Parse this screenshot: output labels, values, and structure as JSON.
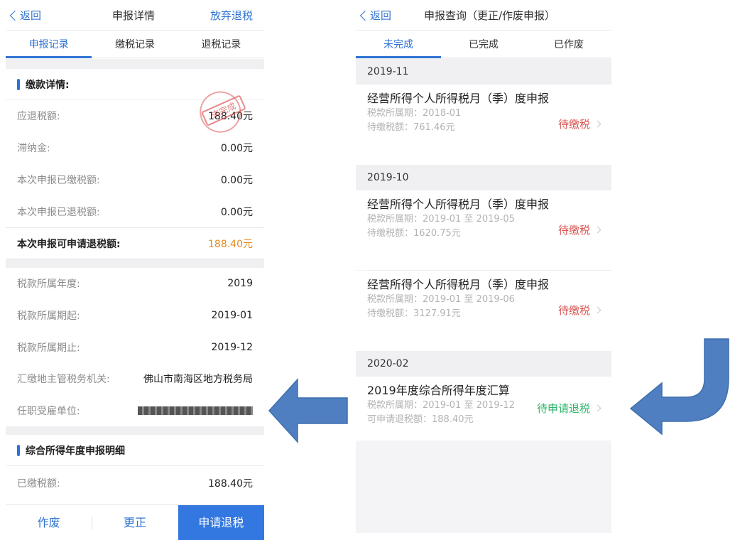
{
  "left": {
    "header": {
      "back_label": "返回",
      "title": "申报详情",
      "action_label": "放弃退税"
    },
    "tabs": [
      "申报记录",
      "缴税记录",
      "退税记录"
    ],
    "payment_section_title": "缴款详情:",
    "stamp_text": "未完成",
    "rows": [
      {
        "label": "应退税额:",
        "value": "188.40元"
      },
      {
        "label": "滞纳金:",
        "value": "0.00元"
      },
      {
        "label": "本次申报已缴税额:",
        "value": "0.00元"
      },
      {
        "label": "本次申报已退税额:",
        "value": "0.00元"
      }
    ],
    "refundable": {
      "label": "本次申报可申请退税额:",
      "value": "188.40元"
    },
    "info_rows": [
      {
        "label": "税款所属年度:",
        "value": "2019"
      },
      {
        "label": "税款所属期起:",
        "value": "2019-01"
      },
      {
        "label": "税款所属期止:",
        "value": "2019-12"
      },
      {
        "label": "汇缴地主管税务机关:",
        "value": "佛山市南海区地方税务局"
      },
      {
        "label": "任职受雇单位:",
        "value": ""
      }
    ],
    "detail_section_title": "综合所得年度申报明细",
    "detail_rows": [
      {
        "label": "已缴税额:",
        "value": "188.40元"
      }
    ],
    "footer": {
      "void_label": "作废",
      "correct_label": "更正",
      "refund_label": "申请退税"
    }
  },
  "right": {
    "header": {
      "back_label": "返回",
      "title": "申报查询（更正/作废申报）"
    },
    "tabs": [
      "未完成",
      "已完成",
      "已作废"
    ],
    "groups": [
      {
        "month": "2019-11",
        "items": [
          {
            "title": "经营所得个人所得税月（季）度申报",
            "period": "税款所属期：2018-01",
            "amount": "待缴税额：761.46元",
            "status": "待缴税"
          }
        ]
      },
      {
        "month": "2019-10",
        "items": [
          {
            "title": "经营所得个人所得税月（季）度申报",
            "period": "税款所属期：2019-01 至 2019-05",
            "amount": "待缴税额：1620.75元",
            "status": "待缴税"
          },
          {
            "title": "经营所得个人所得税月（季）度申报",
            "period": "税款所属期：2019-01 至 2019-06",
            "amount": "待缴税额：3127.91元",
            "status": "待缴税"
          }
        ]
      },
      {
        "month": "2020-02",
        "items": [
          {
            "title": "2019年度综合所得年度汇算",
            "period": "税款所属期：2019-01 至 2019-12",
            "amount": "可申请退税额：188.40元",
            "status": "待申请退税"
          }
        ]
      }
    ]
  },
  "colors": {
    "accent": "#2e72d2",
    "pending_tax": "#d9534f",
    "pending_refund": "#2fb36a",
    "refund_amount": "#e58a1f",
    "arrow": "#4f7fc0"
  }
}
